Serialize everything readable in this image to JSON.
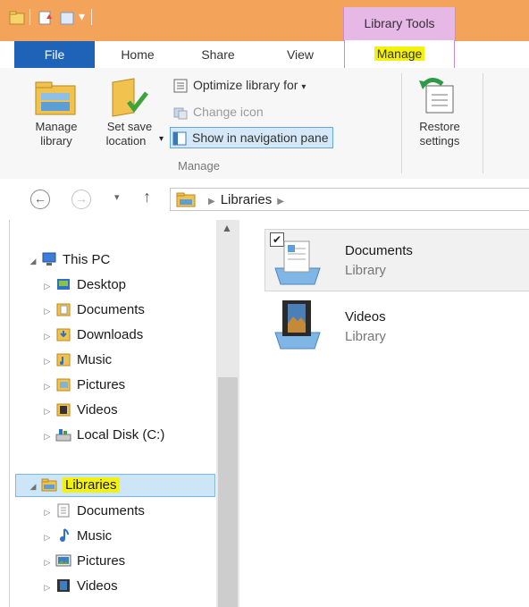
{
  "window": {
    "context_tab_group": "Library Tools"
  },
  "ribbon": {
    "tabs": [
      "File",
      "Home",
      "Share",
      "View",
      "Manage"
    ],
    "buttons": {
      "manage_library": "Manage library",
      "manage_library_l1": "Manage",
      "manage_library_l2": "library",
      "set_save_location_l1": "Set save",
      "set_save_location_l2": "location",
      "optimize_library_for": "Optimize library for",
      "change_icon": "Change icon",
      "show_in_navigation_pane": "Show in navigation pane",
      "restore_settings_l1": "Restore",
      "restore_settings_l2": "settings"
    },
    "group_label": "Manage",
    "highlight_color": "#f4f20a",
    "accent_color": "#1e63b8"
  },
  "address_bar": {
    "breadcrumb": [
      "Libraries"
    ]
  },
  "nav_pane": {
    "this_pc": {
      "label": "This PC",
      "children": [
        "Desktop",
        "Documents",
        "Downloads",
        "Music",
        "Pictures",
        "Videos",
        "Local Disk (C:)"
      ]
    },
    "libraries": {
      "label": "Libraries",
      "children": [
        "Documents",
        "Music",
        "Pictures",
        "Videos"
      ]
    }
  },
  "content": {
    "items": [
      {
        "name": "Documents",
        "type": "Library",
        "selected": true
      },
      {
        "name": "Videos",
        "type": "Library",
        "selected": false
      }
    ]
  }
}
